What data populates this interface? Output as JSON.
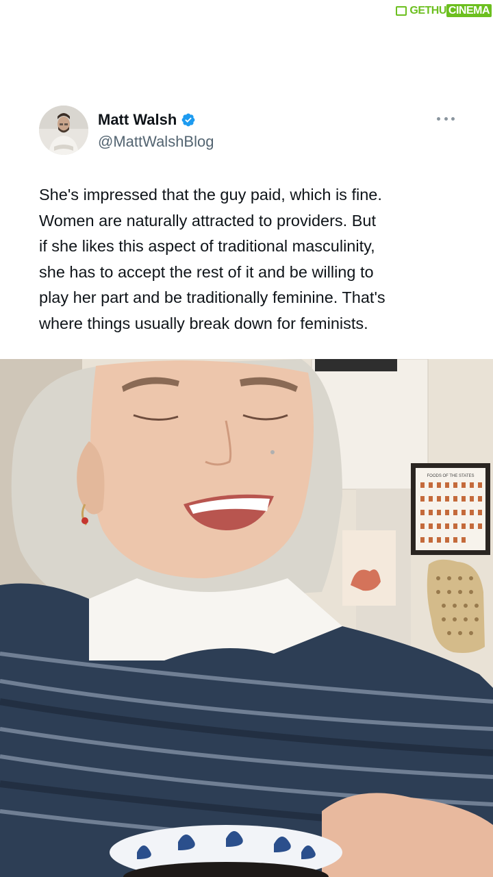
{
  "watermark": {
    "part1": "GETHU",
    "part2": "CINEMA"
  },
  "tweet": {
    "author": {
      "name": "Matt Walsh",
      "handle": "@MattWalshBlog",
      "verified": true,
      "avatar_icon": "profile-photo",
      "verified_color": "#1d9bf0"
    },
    "more_icon": "ellipsis-icon",
    "text_lines": [
      "She's impressed that the guy paid, which is fine.",
      "Women are naturally attracted to providers. But",
      "if she likes this aspect of traditional masculinity,",
      "she has to accept the rest of it and be willing to",
      "play her part and be traditionally feminine. That's",
      "where things usually break down for feminists."
    ]
  },
  "media": {
    "type": "video-frame",
    "framed_print_heading": "FOODS OF THE STATES"
  },
  "colors": {
    "text": "#0f1419",
    "muted": "#536471",
    "watermark_green": "#6cbf1f"
  }
}
